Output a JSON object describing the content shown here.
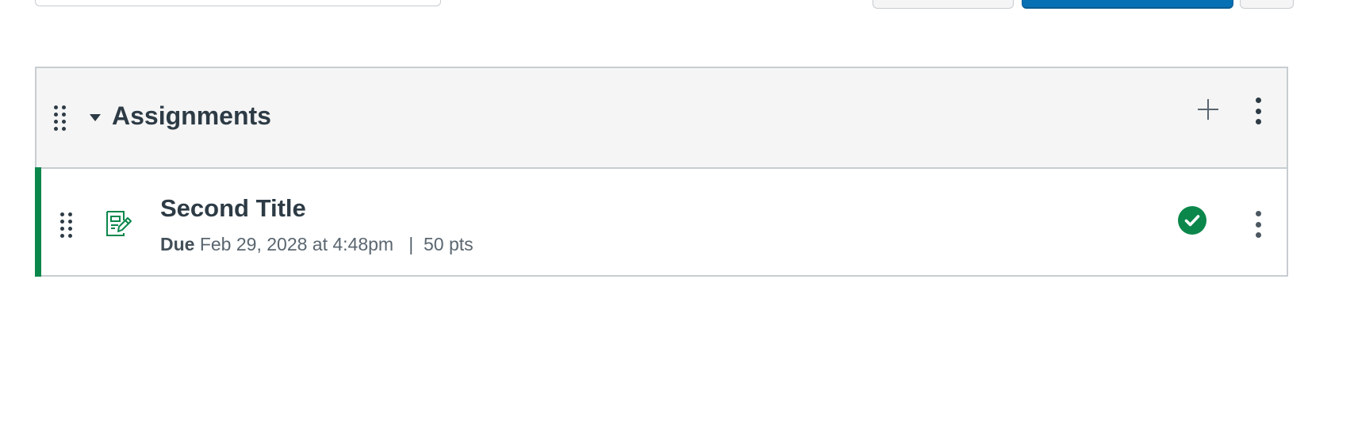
{
  "toolbar": {
    "search": {
      "value": "",
      "placeholder": ""
    },
    "buttons": [
      {
        "name": "secondary-button",
        "label": ""
      },
      {
        "name": "primary-button",
        "label": ""
      },
      {
        "name": "options-button",
        "label": ""
      }
    ]
  },
  "module": {
    "title": "Assignments",
    "expanded": true,
    "icons": {
      "drag": "drag-handle-icon",
      "toggle": "caret-down-icon",
      "add": "plus-icon",
      "menu": "kebab-menu-icon"
    },
    "items": [
      {
        "title": "Second Title",
        "type_icon": "assignment-icon",
        "due_label": "Due",
        "due_date": "Feb 29, 2028 at 4:48pm",
        "separator": "|",
        "points": "50 pts",
        "published": true,
        "status_icon": "published-check-icon"
      }
    ]
  },
  "colors": {
    "accent_green": "#0b874b",
    "primary_blue": "#0770b4",
    "header_bg": "#f5f5f5",
    "border": "#c7cdd1",
    "text_dark": "#2d3b45"
  }
}
